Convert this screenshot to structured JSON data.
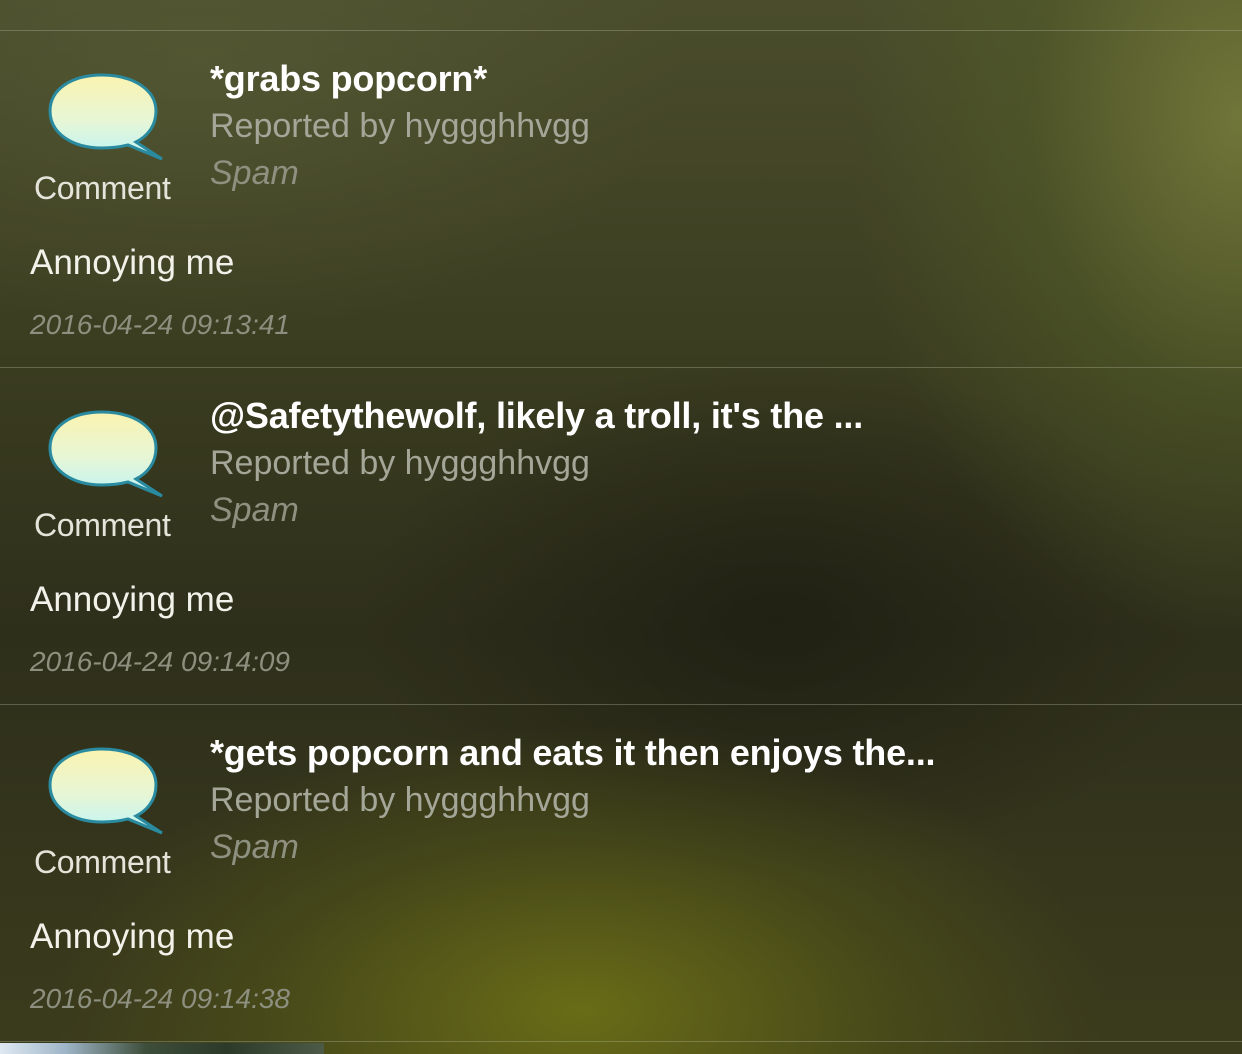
{
  "reports": [
    {
      "type_label": "Comment",
      "icon": "speech-bubble-icon",
      "title": "*grabs popcorn*",
      "reporter": "Reported by hyggghhvgg",
      "reason": "Spam",
      "note": "Annoying me",
      "timestamp": "2016-04-24 09:13:41"
    },
    {
      "type_label": "Comment",
      "icon": "speech-bubble-icon",
      "title": "@Safetythewolf, likely a troll, it's the ...",
      "reporter": "Reported by hyggghhvgg",
      "reason": "Spam",
      "note": "Annoying me",
      "timestamp": "2016-04-24 09:14:09"
    },
    {
      "type_label": "Comment",
      "icon": "speech-bubble-icon",
      "title": "*gets popcorn and eats it then enjoys the...",
      "reporter": "Reported by hyggghhvgg",
      "reason": "Spam",
      "note": "Annoying me",
      "timestamp": "2016-04-24 09:14:38"
    }
  ],
  "colors": {
    "bubble_top": "#fbf3b0",
    "bubble_bottom": "#bff4f7",
    "bubble_stroke": "#2a8aa0",
    "title": "#ffffff",
    "reporter": "#a4a698",
    "reason": "#8e9080",
    "note": "#f2f2ea",
    "timestamp": "#8d8f7f"
  }
}
